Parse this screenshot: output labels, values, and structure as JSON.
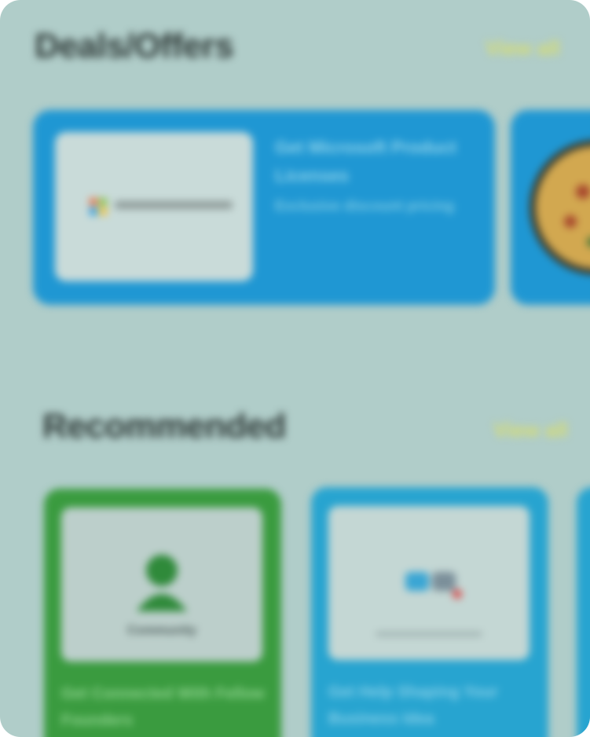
{
  "deals": {
    "title": "Deals/Offers",
    "view_all": "View all",
    "cards": [
      {
        "headline": "Get Microsoft Product Licenses",
        "subtext": "Exclusive discount pricing",
        "logo_text": "Microsoft Partner",
        "color": "#1f97d3"
      },
      {
        "color": "#1f97d3"
      }
    ]
  },
  "recommended": {
    "title": "Recommended",
    "view_all": "View all",
    "cards": [
      {
        "thumb_caption": "Community",
        "headline": "Get Connected With Fellow Founders",
        "color": "#3a9b3f"
      },
      {
        "headline": "Get Help Shaping Your Business Idea",
        "color": "#27a4d0"
      },
      {
        "color": "#27a4d0"
      }
    ]
  }
}
